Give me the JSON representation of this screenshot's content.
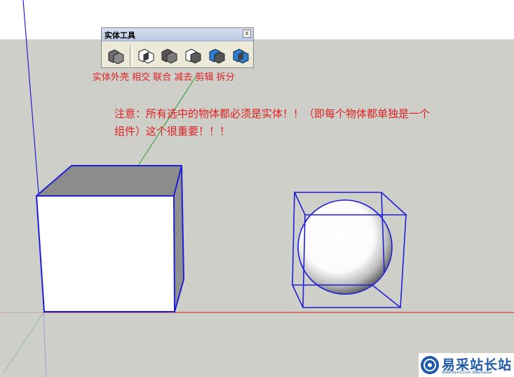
{
  "toolbar": {
    "title": "实体工具",
    "close_label": "x",
    "tools": [
      "outer-shell",
      "intersect",
      "union",
      "subtract",
      "trim",
      "split"
    ]
  },
  "labels": {
    "text": "实体外壳 相交 联合 减去 剪辑 拆分"
  },
  "note": {
    "line1": "注意：所有选中的物体都必须是实体！！（即每个物体都单独是一个",
    "line2": "组件）这个很重要！！！"
  },
  "watermark": {
    "text": "易采站长站",
    "sub": "Www.Easck.Com  Webmaster"
  },
  "colors": {
    "accent_red": "#e02020",
    "selection_blue": "#1f1fd6",
    "ground": "#cfcfca",
    "brand_blue": "#1e5aa8"
  }
}
